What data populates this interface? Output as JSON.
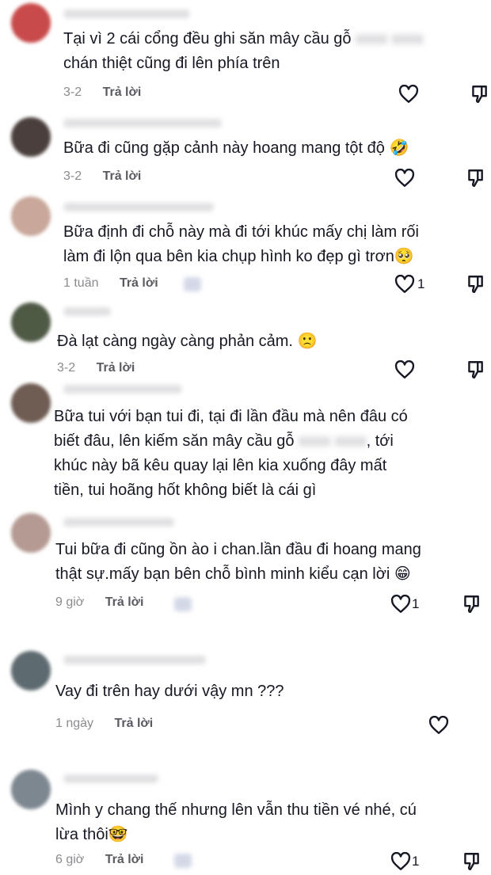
{
  "comments": [
    {
      "text_before": "Tại vì 2 cái cổng đều ghi săn mây cầu gỗ ",
      "redacted": "xxxx xxxx",
      "text_after": "\nchán thiệt cũng đi lên phía trên",
      "time": "3-2",
      "reply": "Trả lời",
      "likes": ""
    },
    {
      "text_before": "Bữa đi cũng gặp cảnh này hoang mang tột độ 🤣",
      "redacted": "",
      "text_after": "",
      "time": "3-2",
      "reply": "Trả lời",
      "likes": ""
    },
    {
      "text_before": "Bữa định đi chỗ này mà đi tới khúc mấy chị làm rối\nlàm đi lộn qua bên kia chụp hình ko đẹp gì trơn🥺",
      "redacted": "",
      "text_after": "",
      "time": "1 tuần",
      "reply": "Trả lời",
      "likes": "1"
    },
    {
      "text_before": "Đà lạt càng ngày càng phản cảm. 🙁",
      "redacted": "",
      "text_after": "",
      "time": "3-2",
      "reply": "Trả lời",
      "likes": ""
    },
    {
      "text_before": "Bữa tui với bạn tui đi, tại đi lần đầu mà nên đâu có\nbiết đâu, lên kiếm săn mây cầu gỗ ",
      "redacted": "xxxx xxxx",
      "text_after": ", tới\nkhúc này bã kêu quay lại lên kia xuống đây mất\ntiền, tui hoãng hốt không biết là cái gì",
      "time": "",
      "reply": "",
      "likes": ""
    },
    {
      "text_before": "Tui bữa đi cũng ồn ào i chan.lần đầu đi hoang mang\nthật sự.mấy bạn bên chỗ bình minh kiểu cạn lời 😁",
      "redacted": "",
      "text_after": "",
      "time": "9 giờ",
      "reply": "Trả lời",
      "likes": "1"
    },
    {
      "text_before": "Vay đi trên hay dưới vậy mn ???",
      "redacted": "",
      "text_after": "",
      "time": "1 ngày",
      "reply": "Trả lời",
      "likes": ""
    },
    {
      "text_before": "Mình y chang thế nhưng lên vẫn thu tiền vé nhé, cú\nlừa thôi🤓",
      "redacted": "",
      "text_after": "",
      "time": "6 giờ",
      "reply": "Trả lời",
      "likes": "1"
    }
  ],
  "colors": {
    "text": "#161823",
    "meta": "#8a8b91",
    "reply": "#5a5b62",
    "avatar_1": "#c94a4a",
    "avatar_2": "#4a3f3c",
    "avatar_3": "#c9a79a",
    "avatar_4": "#4f5a45",
    "avatar_5": "#6f5c53",
    "avatar_6": "#b59a93",
    "avatar_7": "#5d6a6f",
    "avatar_8": "#7d8790"
  },
  "icons": [
    "heart-outline-icon",
    "dislike-icon"
  ]
}
